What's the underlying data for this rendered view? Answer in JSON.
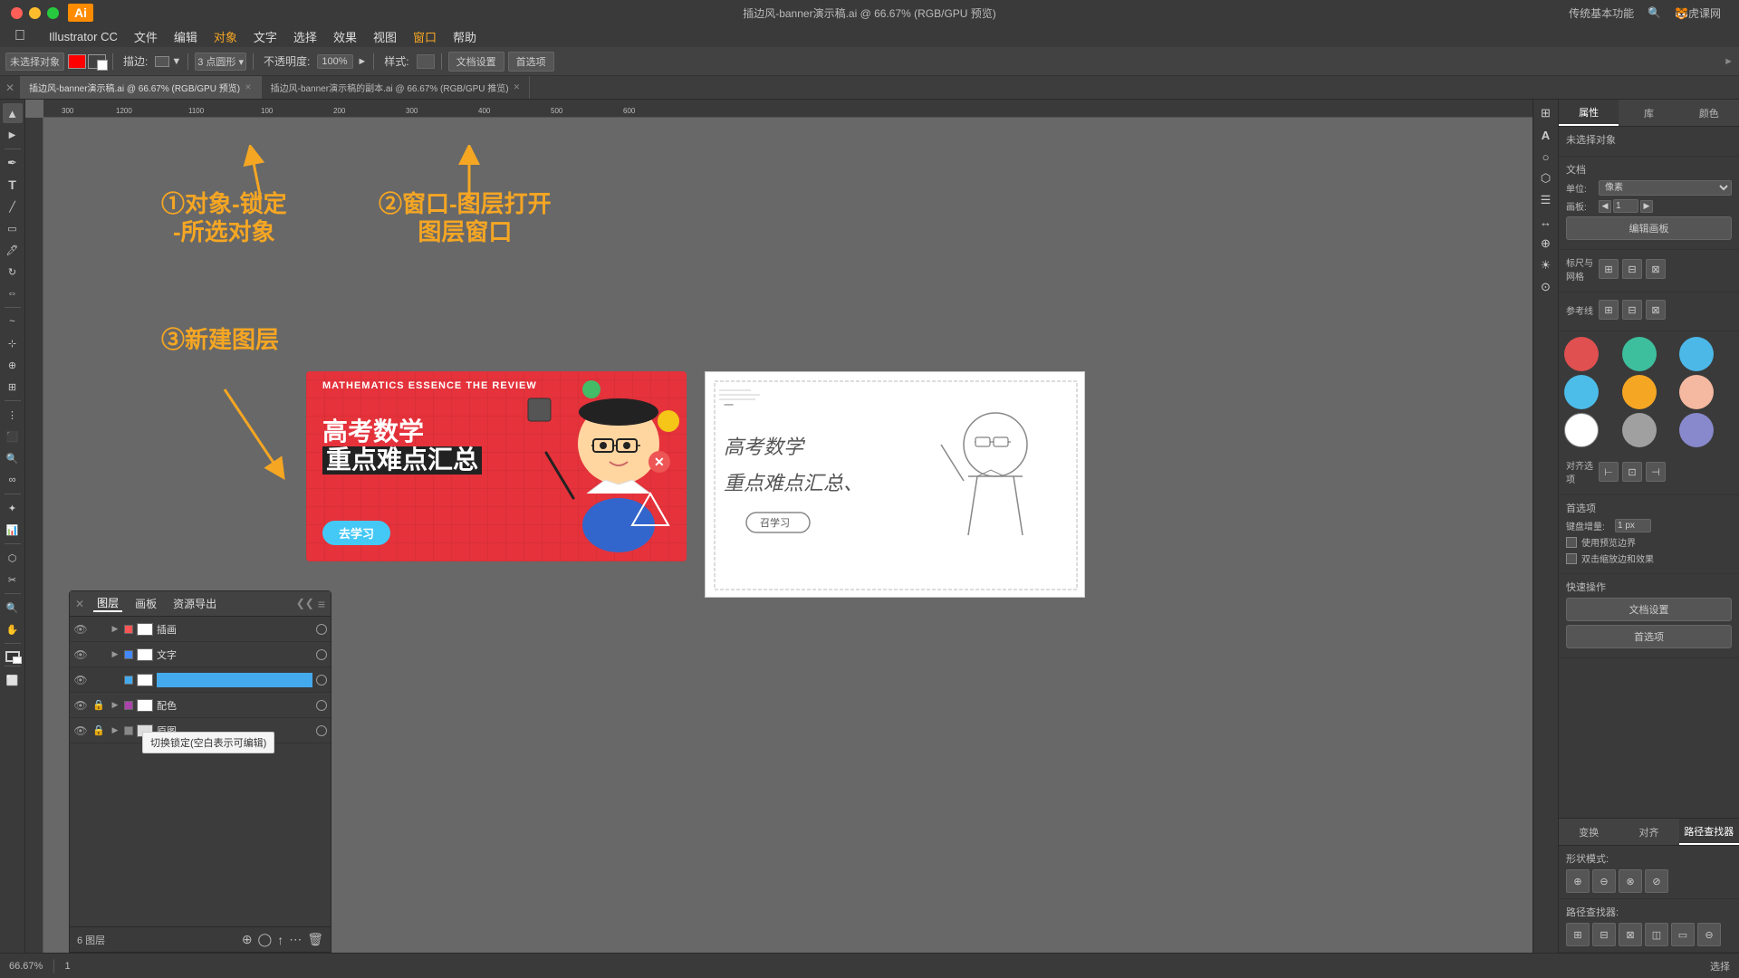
{
  "titlebar": {
    "app_name": "Illustrator CC",
    "title": "插边风-banner演示稿.ai @ 66.67% (RGB/GPU 预览)",
    "right_items": [
      "传统基本功能",
      "🔍",
      "🐯虎课网"
    ]
  },
  "menubar": {
    "apple": "",
    "items": [
      "Illustrator CC",
      "文件",
      "编辑",
      "对象",
      "文字",
      "选择",
      "效果",
      "视图",
      "窗口",
      "帮助"
    ]
  },
  "toolbar": {
    "label": "未选择对象",
    "stroke_label": "描边:",
    "stroke_value": "3 点圆形",
    "opacity_label": "不透明度:",
    "opacity_value": "100%",
    "style_label": "样式:",
    "doc_settings": "文档设置",
    "preferences": "首选项"
  },
  "tabs": [
    {
      "label": "插边风-banner演示稿.ai @ 66.67% (RGB/GPU 预览)",
      "active": true
    },
    {
      "label": "插边风-banner演示稿的副本.ai @ 66.67% (RGB/GPU 推览)",
      "active": false
    }
  ],
  "annotations": {
    "ann1": "①对象-锁定\n-所选对象",
    "ann2": "②窗口-图层打开\n图层窗口",
    "ann3": "③新建图层"
  },
  "layers_panel": {
    "title_tabs": [
      "图层",
      "画板",
      "资源导出"
    ],
    "layers": [
      {
        "name": "插画",
        "visible": true,
        "locked": false,
        "color": "#ff0000",
        "circle": true
      },
      {
        "name": "文字",
        "visible": true,
        "locked": false,
        "color": "#0066ff",
        "circle": true
      },
      {
        "name": "",
        "visible": true,
        "locked": false,
        "color": "#00aaff",
        "editing": true,
        "circle": true
      },
      {
        "name": "配色",
        "visible": true,
        "locked": true,
        "color": "#aa44aa",
        "has_children": true,
        "circle": true
      },
      {
        "name": "原图",
        "visible": true,
        "locked": true,
        "color": "#888888",
        "has_children": true,
        "circle": true
      }
    ],
    "footer_text": "6 图层",
    "tooltip": "切换锁定(空白表示可编辑)"
  },
  "right_panel": {
    "tabs": [
      "属性",
      "库",
      "颜色"
    ],
    "no_selection": "未选择对象",
    "doc_section": "文档",
    "unit_label": "单位:",
    "unit_value": "像素",
    "template_label": "画板:",
    "template_value": "1",
    "edit_template_btn": "编辑画板",
    "grid_section": "标尺与网格",
    "guides_section": "参考线",
    "align_section": "对齐选项",
    "prefs_section": "首选项",
    "keyboard_increment_label": "键盘增量:",
    "keyboard_increment_value": "1 px",
    "checkbox1": "使用预览边界",
    "checkbox2": "双击缩放边和效果",
    "quick_actions": "快速操作",
    "doc_settings_btn": "文档设置",
    "preferences_btn": "首选项",
    "swatches": [
      {
        "color": "#e05050",
        "label": "red"
      },
      {
        "color": "#3dbf9e",
        "label": "teal"
      },
      {
        "color": "#4cb8e8",
        "label": "light-blue"
      },
      {
        "color": "#4cbce8",
        "label": "cyan"
      },
      {
        "color": "#f5a623",
        "label": "orange"
      },
      {
        "color": "#f5b8a0",
        "label": "peach"
      },
      {
        "color": "#ffffff",
        "label": "white"
      },
      {
        "color": "#a0a0a0",
        "label": "gray"
      },
      {
        "color": "#8888cc",
        "label": "purple"
      }
    ],
    "bottom_tabs": [
      "变换",
      "对齐",
      "路径查找器"
    ]
  },
  "bottombar": {
    "zoom": "66.67%",
    "artboard": "1",
    "tool": "选择"
  },
  "banner": {
    "en_title": "MATHEMATICS ESSENCE THE REVIEW",
    "cn_title1": "高考数学",
    "cn_title2": "重点难点汇总",
    "btn_label": "去学习"
  },
  "left_tools": [
    "▲",
    "▶",
    "✏",
    "T",
    "▭",
    "⬭",
    "✎",
    "✂",
    "🖊",
    "◯",
    "~",
    "⌀",
    "✦",
    "🔧",
    "☁",
    "⊕",
    "📊",
    "🔍",
    "🖐"
  ],
  "rp_side_icons": [
    "⊞",
    "A",
    "◯",
    "⬡",
    "☰",
    "↔",
    "⊕",
    "☀",
    "⊙"
  ]
}
